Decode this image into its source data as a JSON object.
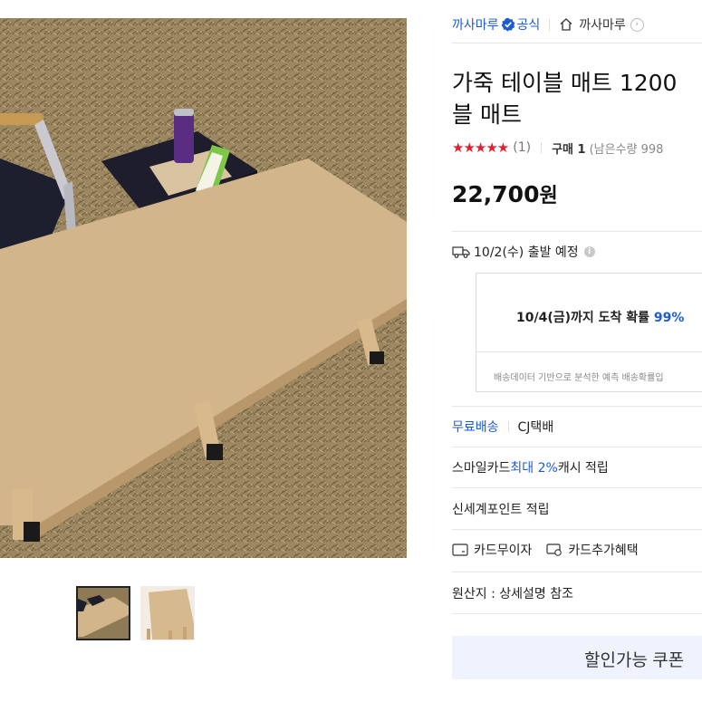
{
  "gallery": {
    "main_image_alt": "가죽 테이블 매트 photo",
    "thumbnails": [
      "thumbnail-1",
      "thumbnail-2"
    ]
  },
  "seller": {
    "brand": "까사마루",
    "official": "공식",
    "store": "까사마루"
  },
  "product": {
    "title_line1": "가죽 테이블 매트 1200 ",
    "title_line2": "블 매트",
    "stars": "★★★★★",
    "review_count": "(1)",
    "purchase": "구매 1",
    "remaining": "(남은수량 998",
    "price": "22,700",
    "currency": "원"
  },
  "shipping": {
    "dispatch": "10/2(수) 출발 예정",
    "arrival_text": "10/4(금)까지 도착 확률 ",
    "arrival_pct": "99%",
    "note": "배송데이터 기반으로 분석한 예측 배송확률입",
    "free": "무료배송",
    "carrier": "CJ택배"
  },
  "benefits": {
    "smile_prefix": "스마일카드 ",
    "smile_highlight": "최대 2%",
    "smile_suffix": " 캐시 적립",
    "shinsegae": "신세계포인트 적립",
    "card_interest": "카드무이자",
    "card_extra": "카드추가혜택"
  },
  "origin": "원산지 : 상세설명 참조",
  "coupon_button": "할인가능 쿠폰",
  "colors": {
    "accent_blue": "#1c5bd6",
    "star_red": "#e61e2e",
    "coupon_bg": "#eef3fd"
  }
}
